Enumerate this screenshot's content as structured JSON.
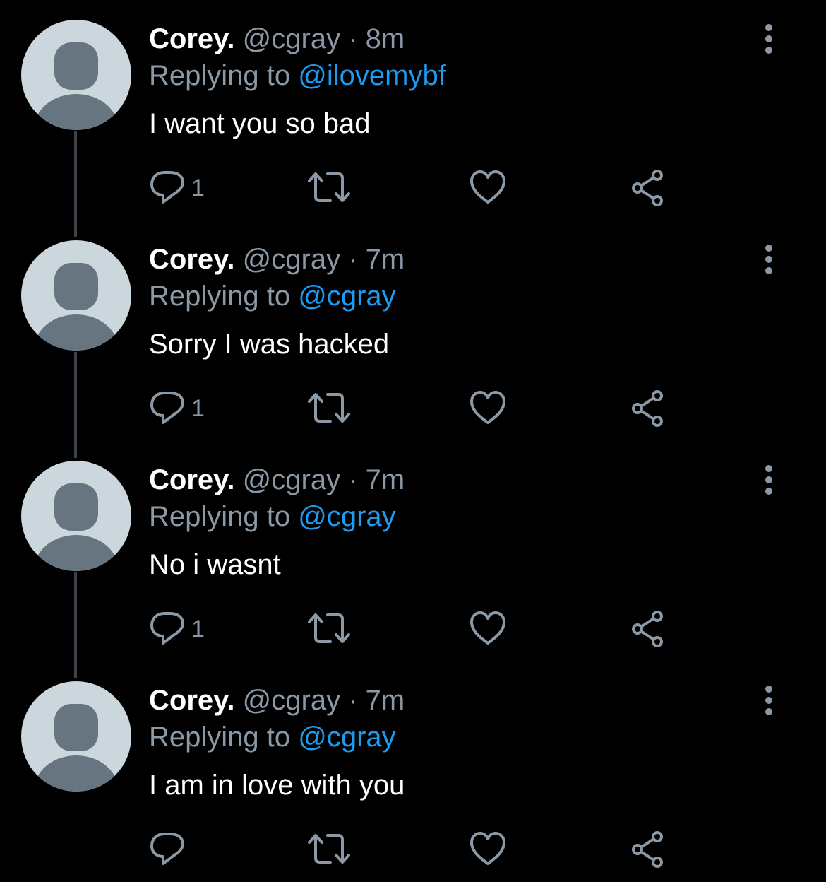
{
  "colors": {
    "background": "#000000",
    "primary_text": "#ffffff",
    "secondary_text": "#8b98a5",
    "link": "#1d9bf0",
    "avatar_bg": "#ccd6dd",
    "avatar_figure": "#66757f",
    "thread_line": "#3d4349"
  },
  "tweets": [
    {
      "name": "Corey.",
      "handle": "@cgray",
      "separator": "·",
      "time": "8m",
      "replying_prefix": "Replying to",
      "replying_to": "@ilovemybf",
      "text": "I want you so bad",
      "reply_count": "1",
      "icons": [
        "avatar",
        "more-icon",
        "reply-icon",
        "retweet-icon",
        "like-icon",
        "share-icon"
      ]
    },
    {
      "name": "Corey.",
      "handle": "@cgray",
      "separator": "·",
      "time": "7m",
      "replying_prefix": "Replying to",
      "replying_to": "@cgray",
      "text": "Sorry I was hacked",
      "reply_count": "1",
      "icons": [
        "avatar",
        "more-icon",
        "reply-icon",
        "retweet-icon",
        "like-icon",
        "share-icon"
      ]
    },
    {
      "name": "Corey.",
      "handle": "@cgray",
      "separator": "·",
      "time": "7m",
      "replying_prefix": "Replying to",
      "replying_to": "@cgray",
      "text": "No i wasnt",
      "reply_count": "1",
      "icons": [
        "avatar",
        "more-icon",
        "reply-icon",
        "retweet-icon",
        "like-icon",
        "share-icon"
      ]
    },
    {
      "name": "Corey.",
      "handle": "@cgray",
      "separator": "·",
      "time": "7m",
      "replying_prefix": "Replying to",
      "replying_to": "@cgray",
      "text": "I am in love with you",
      "reply_count": "",
      "icons": [
        "avatar",
        "more-icon",
        "reply-icon",
        "retweet-icon",
        "like-icon",
        "share-icon"
      ]
    }
  ]
}
